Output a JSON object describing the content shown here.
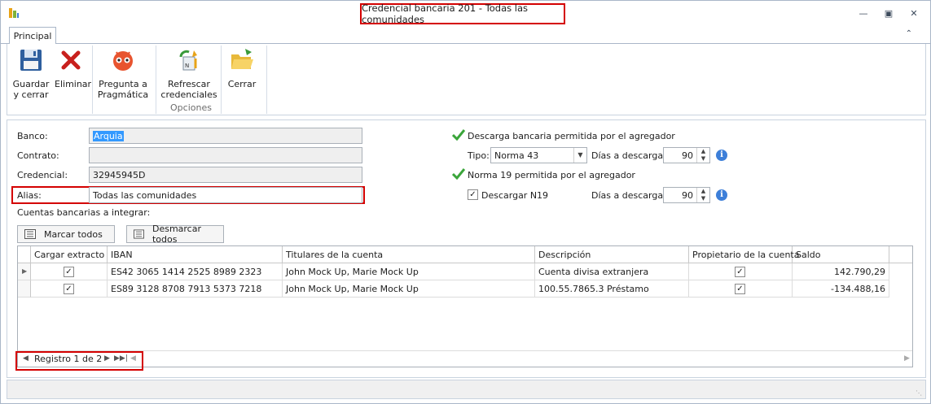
{
  "window": {
    "title": "Credencial bancaria 201  -  Todas las comunidades",
    "minimize_icon": "minimize-icon",
    "restore_icon": "restore-icon",
    "close_icon": "close-icon"
  },
  "ribbon": {
    "tab": "Principal",
    "buttons": {
      "save_close": [
        "Guardar",
        "y cerrar"
      ],
      "delete": "Eliminar",
      "ask": [
        "Pregunta a",
        "Pragmática"
      ],
      "refresh": [
        "Refrescar",
        "credenciales"
      ],
      "close": "Cerrar"
    },
    "group_label": "Opciones"
  },
  "form": {
    "banco_label": "Banco:",
    "banco_value": "Arquia",
    "contrato_label": "Contrato:",
    "contrato_value": "",
    "credencial_label": "Credencial:",
    "credencial_value": "32945945D",
    "alias_label": "Alias:",
    "alias_value": "Todas las comunidades",
    "cuentas_label": "Cuentas bancarias a integrar:",
    "marcar_todos": "Marcar todos",
    "desmarcar_todos": "Desmarcar todos"
  },
  "right_panel": {
    "descarga_permitida": "Descarga bancaria permitida por el agregador",
    "tipo_label": "Tipo:",
    "tipo_value": "Norma 43",
    "dias_label_1": "Días a descargar:",
    "dias_value_1": "90",
    "norma19_permitida": "Norma 19 permitida por el agregador",
    "descargar_n19_label": "Descargar N19",
    "descargar_n19_checked": true,
    "dias_label_2": "Días a descargar:",
    "dias_value_2": "90"
  },
  "grid": {
    "columns": [
      "Cargar extracto",
      "IBAN",
      "Titulares de la cuenta",
      "Descripción",
      "Propietario de la cuenta",
      "Saldo"
    ],
    "rows": [
      {
        "cargar": true,
        "iban": "ES42 3065 1414 2525 8989 2323",
        "titulares": "John Mock Up, Marie Mock Up",
        "descripcion": "Cuenta divisa extranjera",
        "propietario": true,
        "saldo": "142.790,29"
      },
      {
        "cargar": true,
        "iban": "ES89 3128 8708 7913 5373 7218",
        "titulares": "John Mock Up, Marie Mock Up",
        "descripcion": "100.55.7865.3 Préstamo",
        "propietario": true,
        "saldo": "-134.488,16"
      }
    ],
    "navigator": "Registro 1 de 2"
  },
  "colors": {
    "highlight_border": "#d40000",
    "selection": "#3399ff"
  }
}
